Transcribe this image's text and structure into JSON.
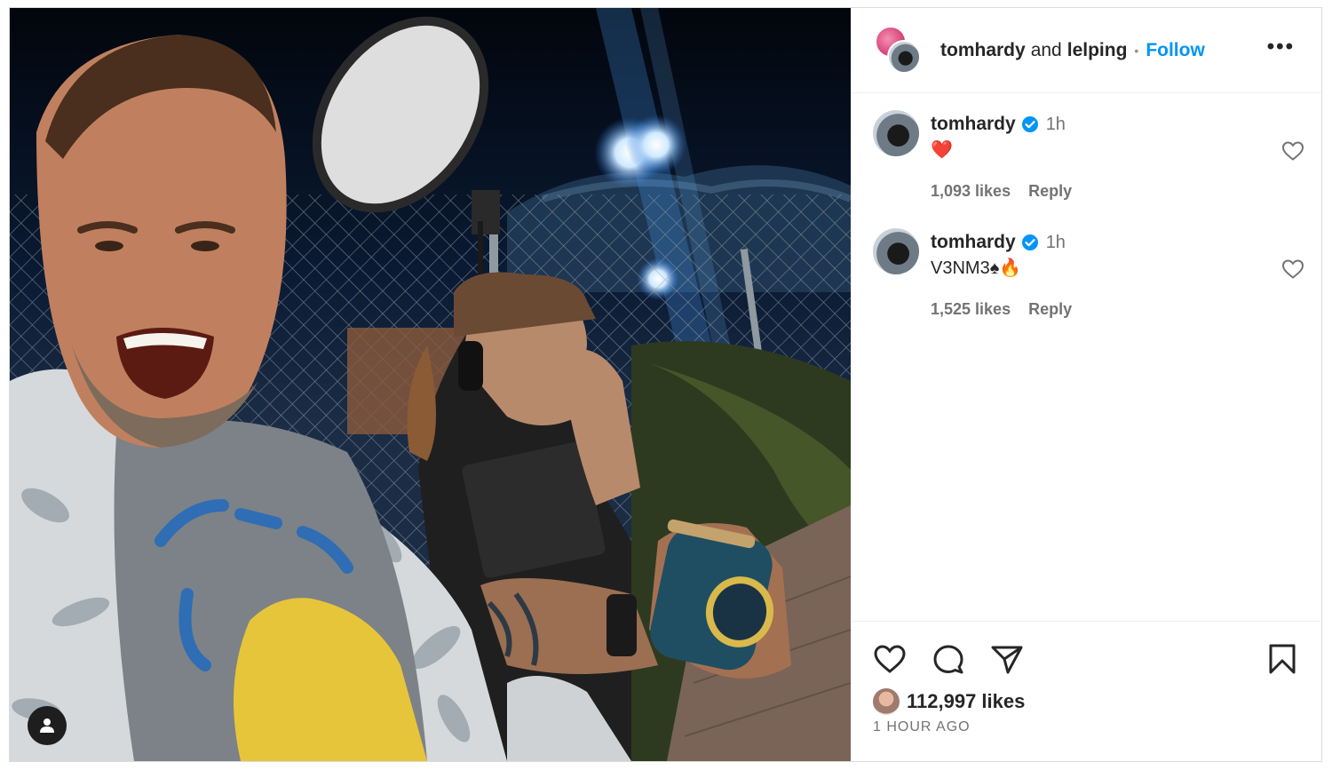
{
  "post": {
    "author_primary": "tomhardy",
    "and_text": "and",
    "author_collab": "lelping",
    "separator": "•",
    "follow_label": "Follow",
    "more_label": "•••"
  },
  "comments": [
    {
      "username": "tomhardy",
      "time": "1h",
      "text": "❤️",
      "likes": "1,093 likes",
      "reply": "Reply"
    },
    {
      "username": "tomhardy",
      "time": "1h",
      "text": "V3NM3♠🔥",
      "likes": "1,525 likes",
      "reply": "Reply"
    }
  ],
  "footer": {
    "likes": "112,997 likes",
    "time_ago": "1 HOUR AGO"
  },
  "colors": {
    "accent": "#0095f6",
    "text": "#262626",
    "muted": "#737373"
  },
  "icons": [
    "heart-icon",
    "comment-icon",
    "share-icon",
    "bookmark-icon",
    "verified-icon",
    "person-tag-icon",
    "more-icon"
  ]
}
